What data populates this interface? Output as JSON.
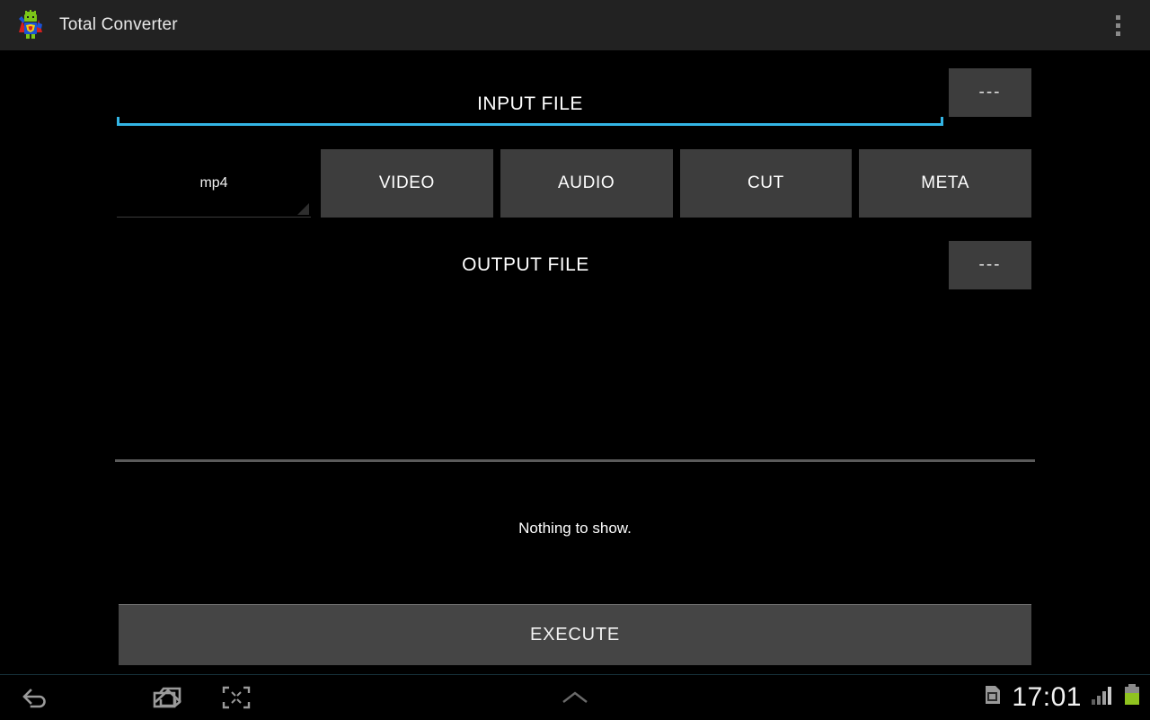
{
  "app": {
    "title": "Total Converter",
    "logo_icon": "android-superhero-icon",
    "overflow_icon": "overflow-menu-icon"
  },
  "form": {
    "input_file": {
      "label": "INPUT FILE",
      "value": "",
      "placeholder": "INPUT FILE",
      "browse_label": "---",
      "focus_color": "#33b5e5"
    },
    "format_spinner": {
      "value": "mp4",
      "caret_icon": "spinner-caret-icon"
    },
    "tabs": [
      {
        "label": "VIDEO",
        "name": "tab-video"
      },
      {
        "label": "AUDIO",
        "name": "tab-audio"
      },
      {
        "label": "CUT",
        "name": "tab-cut"
      },
      {
        "label": "META",
        "name": "tab-meta"
      }
    ],
    "output_file": {
      "label": "OUTPUT FILE",
      "value": "",
      "placeholder": "OUTPUT FILE",
      "browse_label": "---"
    }
  },
  "list": {
    "empty_message": "Nothing to show."
  },
  "actions": {
    "execute_label": "EXECUTE"
  },
  "navbar": {
    "back_icon": "back-arrow-icon",
    "home_icon": "home-icon",
    "recents_icon": "recent-apps-icon",
    "shrink_icon": "shrink-screen-icon",
    "drawer_icon": "chevron-up-icon"
  },
  "status": {
    "storage_icon": "sd-card-icon",
    "clock": "17:01",
    "signal_icon": "signal-bars-icon",
    "battery_icon": "battery-icon",
    "battery_color": "#8fc31f"
  },
  "colors": {
    "background": "#000000",
    "titlebar": "#222222",
    "button": "#3d3d3d",
    "execute_button": "#454545",
    "divider": "#5a5a5a",
    "accent": "#33b5e5"
  }
}
